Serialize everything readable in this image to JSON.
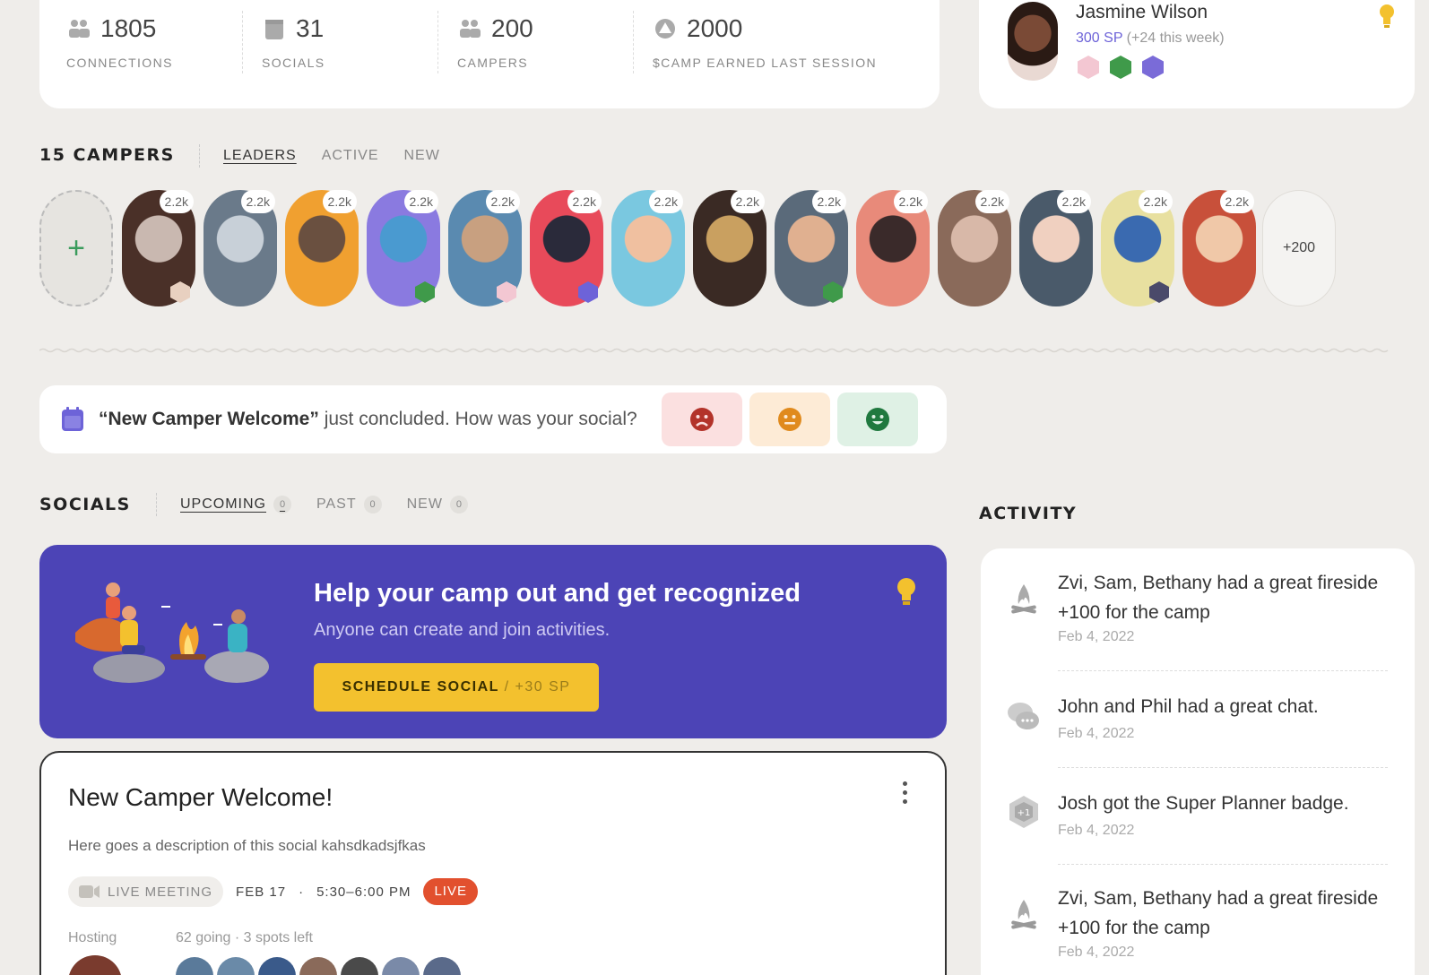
{
  "stats": [
    {
      "value": "1805",
      "label": "CONNECTIONS",
      "icon": "people-icon"
    },
    {
      "value": "31",
      "label": "SOCIALS",
      "icon": "calendar-icon"
    },
    {
      "value": "200",
      "label": "CAMPERS",
      "icon": "people-icon"
    },
    {
      "value": "2000",
      "label": "$CAMP EARNED LAST SESSION",
      "icon": "camp-token-icon"
    }
  ],
  "profile": {
    "name": "Jasmine Wilson",
    "sp": "300 SP",
    "sp_week": " (+24 this week)"
  },
  "campers": {
    "title": "15 CAMPERS",
    "tabs": [
      "LEADERS",
      "ACTIVE",
      "NEW"
    ],
    "add_label": "+",
    "score": "2.2k",
    "more": "+200"
  },
  "feedback": {
    "social_name": "“New Camper Welcome”",
    "text": " just concluded. How was your social?"
  },
  "socials": {
    "title": "SOCIALS",
    "tabs": [
      {
        "label": "UPCOMING",
        "count": "0"
      },
      {
        "label": "PAST",
        "count": "0"
      },
      {
        "label": "NEW",
        "count": "0"
      }
    ]
  },
  "promo": {
    "title": "Help your camp out and get recognized",
    "subtitle": "Anyone can create and join activities.",
    "button": "SCHEDULE SOCIAL",
    "button_sp": "/ +30 SP"
  },
  "social_card": {
    "title": "New Camper Welcome!",
    "description": "Here goes a description of this social kahsdkadsjfkas",
    "meeting_type": "LIVE MEETING",
    "date": "FEB 17",
    "time": "5:30–6:00 PM",
    "status": "LIVE",
    "hosting_label": "Hosting",
    "going": "62 going · 3 spots left"
  },
  "activity": {
    "title": "ACTIVITY",
    "items": [
      {
        "text": "Zvi, Sam, Bethany had a great fireside +100 for the camp",
        "date": "Feb 4, 2022",
        "icon": "campfire-icon"
      },
      {
        "text": "John and Phil had a great chat.",
        "date": "Feb 4, 2022",
        "icon": "chat-icon"
      },
      {
        "text": "Josh got the Super Planner badge.",
        "date": "Feb 4, 2022",
        "icon": "badge-icon"
      },
      {
        "text": "Zvi, Sam, Bethany had a great fireside +100 for the camp",
        "date": "Feb 4, 2022",
        "icon": "campfire-icon"
      }
    ]
  },
  "colors": {
    "accent": "#4c44b6",
    "button": "#f3c12e",
    "live": "#e2502e",
    "green": "#3a9b5c"
  }
}
